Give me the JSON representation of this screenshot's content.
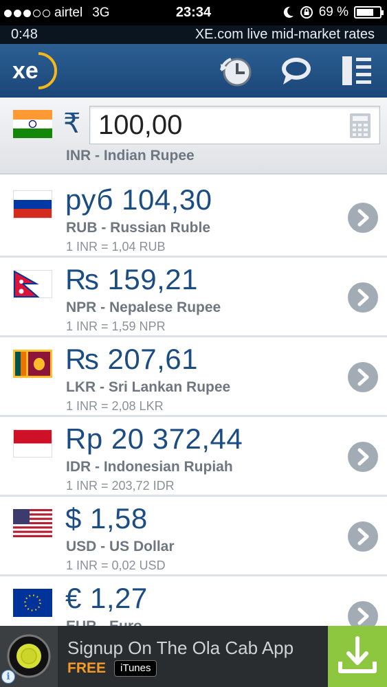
{
  "status_bar": {
    "carrier": "airtel",
    "network": "3G",
    "time": "23:34",
    "battery": "69 %",
    "signal_dots_filled": 3,
    "signal_dots_total": 5
  },
  "timer_bar": {
    "elapsed": "0:48",
    "title": "XE.com live mid-market rates"
  },
  "header": {
    "logo_text": "xe",
    "icons": [
      "history-icon",
      "chat-icon",
      "menu-icon"
    ],
    "accent": "#1b4679"
  },
  "from_currency": {
    "symbol": "₹",
    "amount": "100,00",
    "name": "INR - Indian Rupee",
    "flag": "india"
  },
  "rows": [
    {
      "amount": "руб 104,30",
      "name": "RUB - Russian Ruble",
      "rate": "1 INR = 1,04 RUB",
      "flag": "russia"
    },
    {
      "amount": "₨ 159,21",
      "name": "NPR - Nepalese Rupee",
      "rate": "1 INR = 1,59 NPR",
      "flag": "nepal"
    },
    {
      "amount": "₨ 207,61",
      "name": "LKR - Sri Lankan Rupee",
      "rate": "1 INR = 2,08 LKR",
      "flag": "sri-lanka"
    },
    {
      "amount": "Rp 20 372,44",
      "name": "IDR - Indonesian Rupiah",
      "rate": "1 INR = 203,72 IDR",
      "flag": "indonesia"
    },
    {
      "amount": "$ 1,58",
      "name": "USD - US Dollar",
      "rate": "1 INR = 0,02 USD",
      "flag": "usa"
    },
    {
      "amount": "€ 1,27",
      "name": "EUR - Euro",
      "rate": "",
      "flag": "eu"
    }
  ],
  "ad": {
    "title": "Signup On The Ola Cab App",
    "price": "FREE",
    "store": "iTunes",
    "info": "i"
  }
}
